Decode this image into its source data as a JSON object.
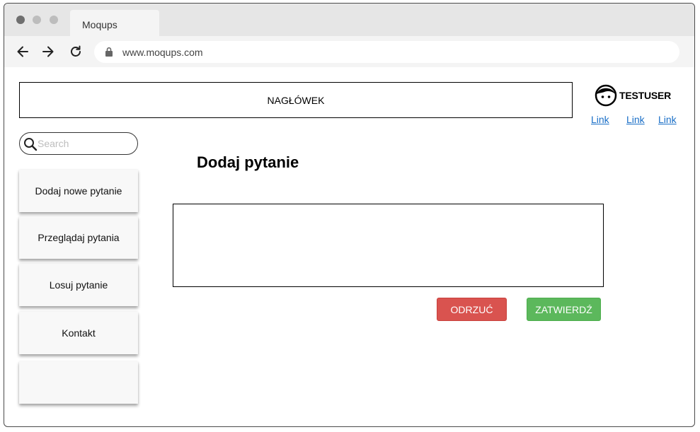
{
  "browser": {
    "tab_title": "Moqups",
    "url": "www.moqups.com"
  },
  "header": {
    "title": "NAGŁÓWEK",
    "username": "TESTUSER",
    "links": [
      "Link",
      "Link",
      "Link"
    ]
  },
  "sidebar": {
    "search_placeholder": "Search",
    "items": [
      {
        "label": "Dodaj nowe pytanie"
      },
      {
        "label": "Przeglądaj pytania"
      },
      {
        "label": "Losuj pytanie"
      },
      {
        "label": "Kontakt"
      },
      {
        "label": ""
      }
    ]
  },
  "main": {
    "title": "Dodaj pytanie",
    "question_value": "",
    "reject_label": "ODRZUĆ",
    "accept_label": "ZATWIERDŹ"
  },
  "colors": {
    "reject": "#d9534f",
    "accept": "#5cb85c",
    "link": "#1a6fc7"
  },
  "icons": [
    "back-arrow-icon",
    "forward-arrow-icon",
    "reload-icon",
    "lock-icon",
    "avatar-icon",
    "search-icon"
  ]
}
